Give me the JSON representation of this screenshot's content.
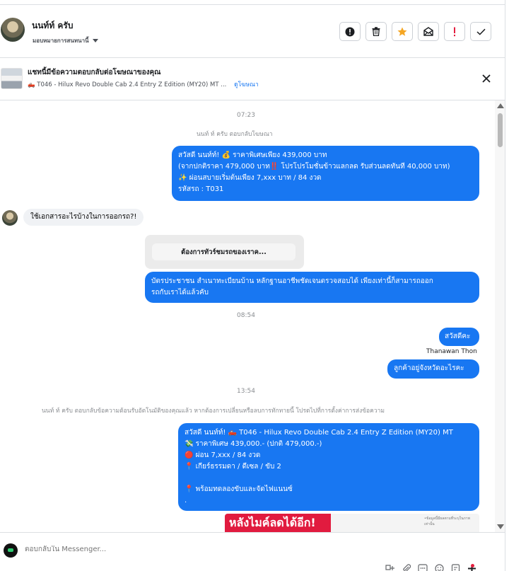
{
  "header": {
    "contact_name": "นนท์ท์ ครับ",
    "assign_label": "มอบหมายการสนทนานี้",
    "action_labels": [
      "Mark as spam",
      "Delete",
      "Star",
      "Mark as unread",
      "Follow up",
      "Mark as done"
    ]
  },
  "ad": {
    "title": "แชทนี้มีข้อความตอบกลับต่อโฆษณาของคุณ",
    "subtitle": "T046 - Hilux Revo Double Cab 2.4 Entry Z Edition (MY20) MT ...",
    "link": "ดูโฆษณา"
  },
  "thread": {
    "time_1": "07:23",
    "note_1": "นนท์ ท์ ครับ ตอบกลับโฆษณา",
    "msg_1": [
      "สวัสดี นนท์ท์! 💰 ราคาพิเศษเพียง 439,000 บาท",
      "(จากปกติราคา 479,000 บาท‼️ โปรโปรโมชั่นข้าวแลกลด รับส่วนลดทันที 40,000 บาท)",
      "✨ ผ่อนสบายเริ่มต้นเพียง 7,xxx บาท / 84 งวด",
      "รหัสรถ : T031"
    ],
    "msg_in_1": "ใช้เอกสารอะไรบ้างในการออกรถ?!",
    "quick_reply": "ต้องการทัวร์ชมรถของเราค...",
    "msg_2": [
      "บัตรประชาชน สำเนาทะเบียนบ้าน หลักฐานอาชีพชัดเจนตรวจสอบได้ เพียงเท่านี้ก็สามารถออก",
      "รถกับเราได้แล้วคับ"
    ],
    "time_2": "08:54",
    "msg_3": "สวัสดีคะ",
    "sender_label": "Thanawan Thon",
    "msg_4": "ลูกค้าอยู่จังหวัดอะไรคะ",
    "time_3": "13:54",
    "note_2": "นนท์ ท์ ครับ ตอบกลับข้อความต้อนรับอัตโนมัติของคุณแล้ว หากต้องการเปลี่ยนหรือลบการทักทายนี้ โปรดไปที่การตั้งค่าการส่งข้อความ",
    "msg_5": [
      "สวัสดี นนท์ท์! 🛻 T046 - Hilux Revo Double Cab 2.4 Entry Z Edition (MY20) MT",
      "💸 ราคาพิเศษ 439,000.- (ปกติ 479,000.-)",
      "🔴 ผ่อน 7,xxx / 84 งวด",
      "📍 เกียร์ธรรมดา / ดีเซล / ขับ 2",
      "",
      "📍 พร้อมทดลองขับและจัดไฟแนนซ์",
      "."
    ],
    "promo_text": "หลังไมค์ลดได้อีก!",
    "promo_small": "•ข้อมูลนี้มีผลตามที่ระบุในภาพเท่านั้น"
  },
  "composer": {
    "placeholder": "ตอบกลับใน Messenger..."
  },
  "colors": {
    "accent": "#1877f2",
    "incoming": "#f0f2f5",
    "star": "#f5a623",
    "alert": "#e41e3f"
  }
}
